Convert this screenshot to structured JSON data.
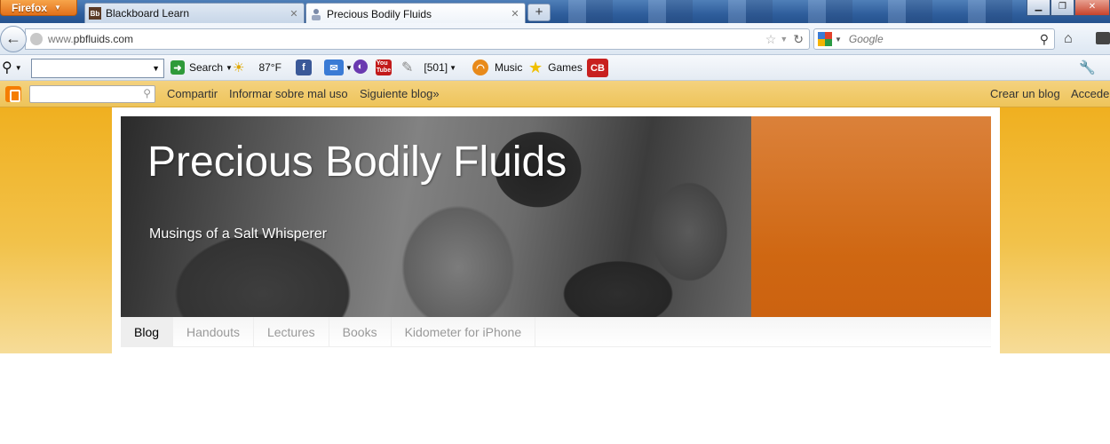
{
  "browser": {
    "menu_button": "Firefox",
    "tabs": [
      {
        "title": "Blackboard Learn",
        "favicon": "Bb",
        "active": false
      },
      {
        "title": "Precious Bodily Fluids",
        "favicon": "person-icon",
        "active": true
      }
    ],
    "new_tab": "+",
    "url_host_prefix": "www.",
    "url_host": "pbfluids.com",
    "search_placeholder": "Google"
  },
  "toolbar": {
    "search_label": "Search",
    "weather": "87°F",
    "counter": "[501]",
    "music_label": "Music",
    "games_label": "Games",
    "cb_label": "CB"
  },
  "blogger": {
    "links": [
      "Compartir",
      "Informar sobre mal uso",
      "Siguiente blog»"
    ],
    "right_links": [
      "Crear un blog",
      "Acceder"
    ]
  },
  "blog": {
    "title": "Precious Bodily Fluids",
    "description": "Musings of a Salt Whisperer",
    "tabs": [
      {
        "label": "Blog",
        "selected": true
      },
      {
        "label": "Handouts",
        "selected": false
      },
      {
        "label": "Lectures",
        "selected": false
      },
      {
        "label": "Books",
        "selected": false
      },
      {
        "label": "Kidometer for iPhone",
        "selected": false
      }
    ]
  },
  "colors": {
    "firefox_orange": "#e2701a",
    "blogger_bar": "#f0c860",
    "header_orange": "#cf6712",
    "page_gradient_top": "#f0b020"
  }
}
